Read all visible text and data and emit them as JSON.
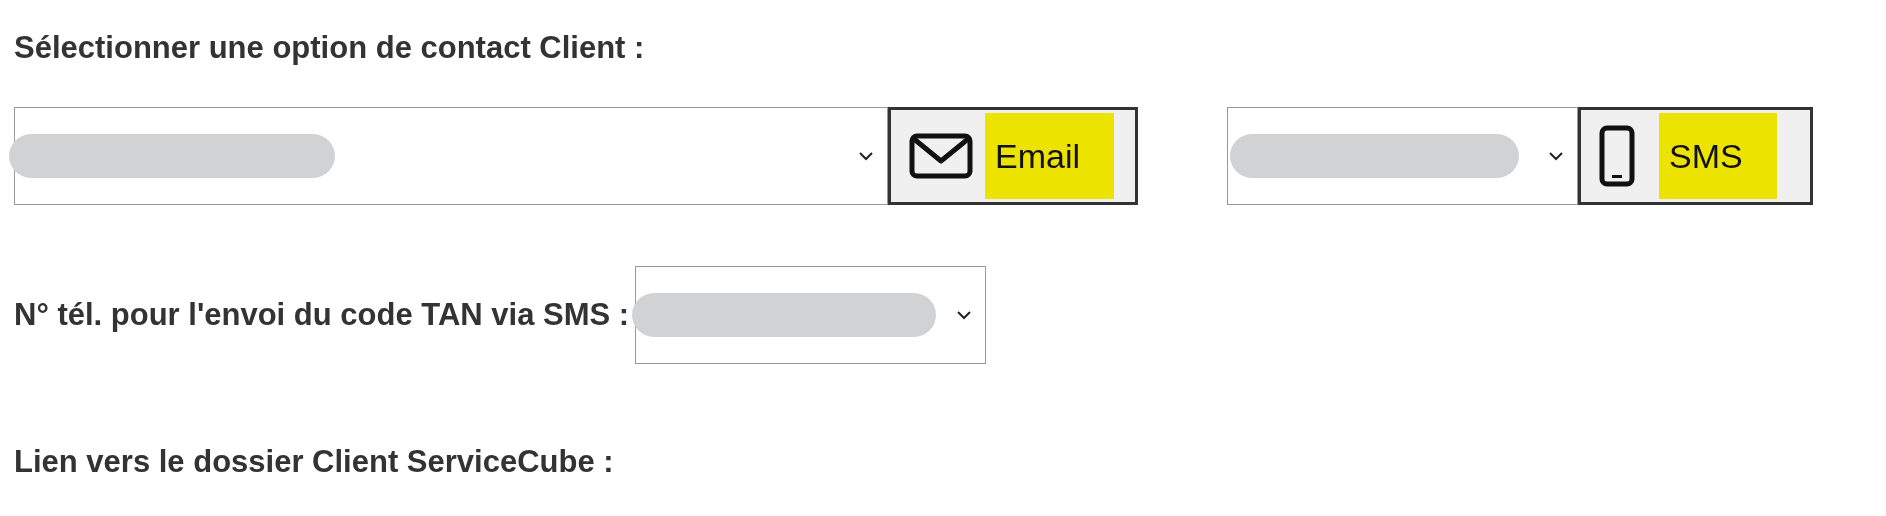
{
  "contact_section": {
    "heading": "Sélectionner une option de contact Client :",
    "options": [
      {
        "kind": "email",
        "button_label": "Email"
      },
      {
        "kind": "sms",
        "button_label": "SMS"
      }
    ]
  },
  "tan_phone": {
    "label": "N° tél. pour l'envoi du code TAN via SMS :"
  },
  "servicecube_link": {
    "label": "Lien vers le dossier Client ServiceCube :"
  }
}
